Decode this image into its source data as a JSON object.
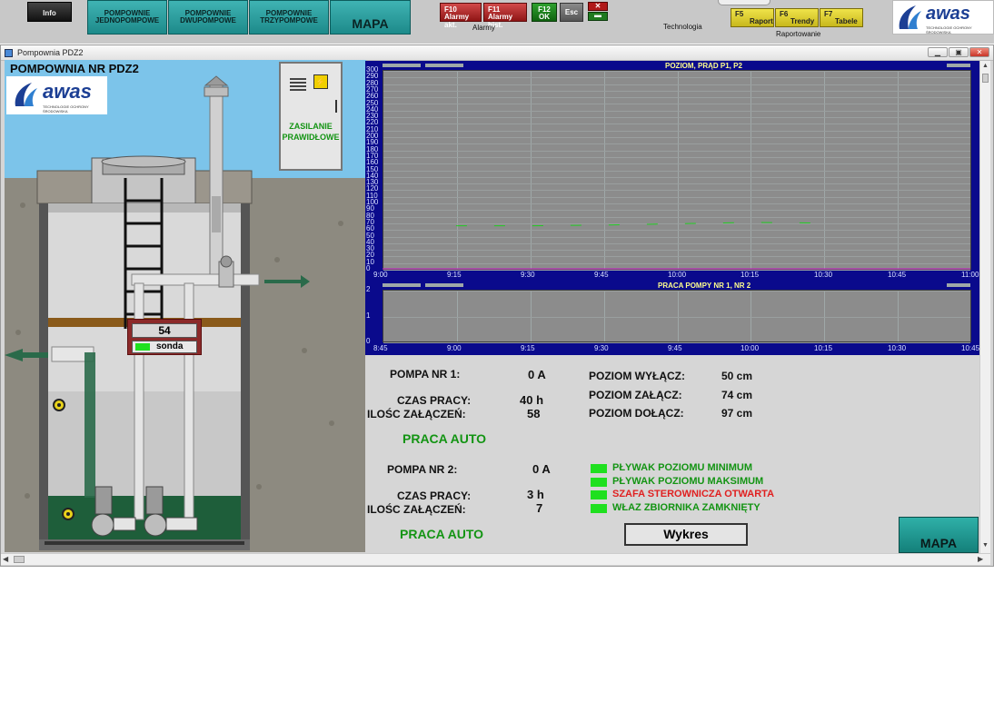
{
  "toolbar": {
    "info": "Info",
    "btn_jedno": "POMPOWNIE\nJEDNOPOMPOWE",
    "btn_dwu": "POMPOWNIE\nDWUPOMPOWE",
    "btn_trzy": "POMPOWNIE\nTRZYPOMPOWE",
    "mapa": "MAPA",
    "f10_key": "F10",
    "f10_label": "Alarmy akt.",
    "f11_key": "F11",
    "f11_label": "Alarmy hist.",
    "f12_key": "F12",
    "f12_label": "OK",
    "esc": "Esc",
    "alarmy_group": "Alarmy",
    "technologia": "Technologia",
    "f5_key": "F5",
    "f5_label": "Raport",
    "f6_key": "F6",
    "f6_label": "Trendy",
    "f7_key": "F7",
    "f7_label": "Tabele",
    "raportowanie": "Raportowanie",
    "logo_text": "awas",
    "logo_sub": "TECHNOLOGIE OCHRONY ŚRODOWISKA"
  },
  "window": {
    "title": "Pompownia PDZ2"
  },
  "scene": {
    "title": "POMPOWNIA NR PDZ2",
    "logo_text": "awas",
    "logo_sub": "TECHNOLOGIE OCHRONY ŚRODOWISKA",
    "cabinet_label1": "ZASILANIE",
    "cabinet_label2": "PRAWIDŁOWE",
    "sonda_value": "54",
    "sonda_label": "sonda"
  },
  "chart_data": [
    {
      "type": "line",
      "title": "POZIOM, PRĄD P1, P2",
      "x": [
        "9:00",
        "9:15",
        "9:30",
        "9:45",
        "10:00",
        "10:15",
        "10:30",
        "10:45",
        "11:00"
      ],
      "yticks": [
        300,
        290,
        280,
        270,
        260,
        250,
        240,
        230,
        220,
        210,
        200,
        190,
        180,
        170,
        160,
        150,
        140,
        130,
        120,
        110,
        100,
        90,
        80,
        70,
        60,
        50,
        40,
        30,
        20,
        10,
        0
      ],
      "ylim": [
        0,
        300
      ],
      "grid": true,
      "series": [
        {
          "values": [
            null,
            65,
            65,
            66,
            68,
            70,
            69,
            null,
            null
          ],
          "color": "#22cc22"
        },
        {
          "values": [
            0,
            0,
            0,
            0,
            0,
            0,
            0,
            0,
            0
          ],
          "color": "#cc22cc"
        }
      ]
    },
    {
      "type": "line",
      "title": "PRACA POMPY NR 1, NR 2",
      "x": [
        "8:45",
        "9:00",
        "9:15",
        "9:30",
        "9:45",
        "10:00",
        "10:15",
        "10:30",
        "10:45"
      ],
      "yticks": [
        2,
        1,
        0
      ],
      "ylim": [
        0,
        2
      ],
      "grid": true
    }
  ],
  "info": {
    "pompa1_label": "POMPA NR 1:",
    "pompa1_current": "0 A",
    "czas1_label": "CZAS PRACY:",
    "czas1_value": "40 h",
    "ilosc1_label": "ILOŚC ZAŁĄCZEŃ:",
    "ilosc1_value": "58",
    "praca1": "PRACA AUTO",
    "wylacz_label": "POZIOM WYŁĄCZ:",
    "wylacz_value": "50 cm",
    "zalacz_label": "POZIOM ZAŁĄCZ:",
    "zalacz_value": "74 cm",
    "dolacz_label": "POZIOM DOŁĄCZ:",
    "dolacz_value": "97 cm",
    "pompa2_label": "POMPA NR 2:",
    "pompa2_current": "0 A",
    "czas2_label": "CZAS PRACY:",
    "czas2_value": "3 h",
    "ilosc2_label": "ILOŚC ZAŁĄCZEŃ:",
    "ilosc2_value": "7",
    "praca2": "PRACA AUTO",
    "ind1": "PŁYWAK POZIOMU MINIMUM",
    "ind2": "PŁYWAK POZIOMU MAKSIMUM",
    "ind3": "SZAFA STEROWNICZA OTWARTA",
    "ind4": "WŁAZ ZBIORNIKA ZAMKNIĘTY",
    "wykres": "Wykres",
    "mapa": "MAPA",
    "colors": {
      "ok": "#139413",
      "alarm": "#e02020",
      "indicator": "#1fe01f"
    }
  }
}
